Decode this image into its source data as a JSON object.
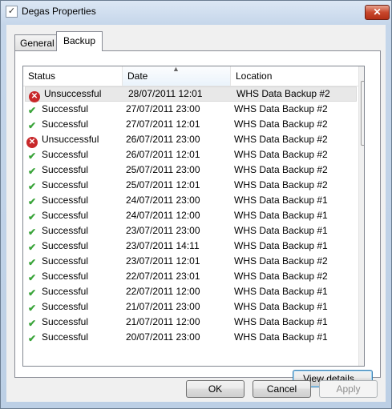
{
  "window": {
    "title": "Degas Properties",
    "close_glyph": "✕"
  },
  "tabs": [
    {
      "label": "General",
      "active": false
    },
    {
      "label": "Backup",
      "active": true
    }
  ],
  "list": {
    "columns": {
      "status": "Status",
      "date": "Date",
      "location": "Location"
    },
    "sorted_column": "date",
    "rows": [
      {
        "status": "Unsuccessful",
        "result": "fail",
        "date": "28/07/2011 12:01",
        "location": "WHS Data Backup #2",
        "selected": true
      },
      {
        "status": "Successful",
        "result": "ok",
        "date": "27/07/2011 23:00",
        "location": "WHS Data Backup #2"
      },
      {
        "status": "Successful",
        "result": "ok",
        "date": "27/07/2011 12:01",
        "location": "WHS Data Backup #2"
      },
      {
        "status": "Unsuccessful",
        "result": "fail",
        "date": "26/07/2011 23:00",
        "location": "WHS Data Backup #2"
      },
      {
        "status": "Successful",
        "result": "ok",
        "date": "26/07/2011 12:01",
        "location": "WHS Data Backup #2"
      },
      {
        "status": "Successful",
        "result": "ok",
        "date": "25/07/2011 23:00",
        "location": "WHS Data Backup #2"
      },
      {
        "status": "Successful",
        "result": "ok",
        "date": "25/07/2011 12:01",
        "location": "WHS Data Backup #2"
      },
      {
        "status": "Successful",
        "result": "ok",
        "date": "24/07/2011 23:00",
        "location": "WHS Data Backup #1"
      },
      {
        "status": "Successful",
        "result": "ok",
        "date": "24/07/2011 12:00",
        "location": "WHS Data Backup #1"
      },
      {
        "status": "Successful",
        "result": "ok",
        "date": "23/07/2011 23:00",
        "location": "WHS Data Backup #1"
      },
      {
        "status": "Successful",
        "result": "ok",
        "date": "23/07/2011 14:11",
        "location": "WHS Data Backup #1"
      },
      {
        "status": "Successful",
        "result": "ok",
        "date": "23/07/2011 12:01",
        "location": "WHS Data Backup #2"
      },
      {
        "status": "Successful",
        "result": "ok",
        "date": "22/07/2011 23:01",
        "location": "WHS Data Backup #2"
      },
      {
        "status": "Successful",
        "result": "ok",
        "date": "22/07/2011 12:00",
        "location": "WHS Data Backup #1"
      },
      {
        "status": "Successful",
        "result": "ok",
        "date": "21/07/2011 23:00",
        "location": "WHS Data Backup #1"
      },
      {
        "status": "Successful",
        "result": "ok",
        "date": "21/07/2011 12:00",
        "location": "WHS Data Backup #1"
      },
      {
        "status": "Successful",
        "result": "ok",
        "date": "20/07/2011 23:00",
        "location": "WHS Data Backup #1"
      }
    ]
  },
  "icons": {
    "success": "check-icon",
    "failure": "error-icon",
    "success_glyph": "✔",
    "failure_glyph": "✕"
  },
  "buttons": {
    "view_details": "View details...",
    "ok": "OK",
    "cancel": "Cancel",
    "apply": "Apply"
  },
  "colors": {
    "success": "#3aa43a",
    "failure": "#c8282a",
    "title_bar": "#c5d6ea",
    "close_button": "#c8472c"
  }
}
